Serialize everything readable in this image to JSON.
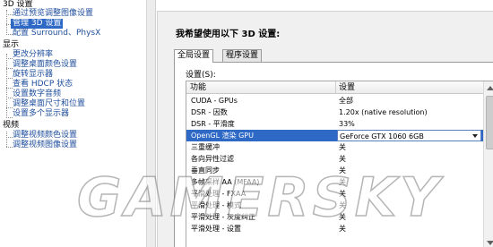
{
  "tree": {
    "categories": [
      {
        "label": "3D 设置",
        "items": [
          "通过预览调整图像设置",
          "管理 3D 设置",
          "配置 Surround、PhysX"
        ]
      },
      {
        "label": "显示",
        "items": [
          "更改分辨率",
          "调整桌面颜色设置",
          "旋转显示器",
          "查看 HDCP 状态",
          "设置数字音频",
          "调整桌面尺寸和位置",
          "设置多个显示器"
        ]
      },
      {
        "label": "视频",
        "items": [
          "调整视频颜色设置",
          "调整视频图像设置"
        ]
      }
    ],
    "selected_item": "管理 3D 设置"
  },
  "panel": {
    "prompt": "我希望使用以下 3D 设置:",
    "tabs": [
      {
        "label": "全局设置",
        "active": true
      },
      {
        "label": "程序设置",
        "active": false
      }
    ],
    "settings_label": "设置(S):",
    "columns": {
      "feature": "功能",
      "setting": "设置"
    },
    "rows": [
      {
        "feature": "CUDA - GPUs",
        "value": "全部"
      },
      {
        "feature": "DSR - 因数",
        "value": "1.20x (native resolution)"
      },
      {
        "feature": "DSR - 平滑度",
        "value": "33%"
      },
      {
        "feature": "OpenGL 渲染 GPU",
        "value": "GeForce GTX 1060 6GB",
        "selected": true
      },
      {
        "feature": "三重缓冲",
        "value": "关"
      },
      {
        "feature": "各向异性过滤",
        "value": "关"
      },
      {
        "feature": "垂直同步",
        "value": "关"
      },
      {
        "feature": "多帧采样 AA (MFAA)",
        "value": "关"
      },
      {
        "feature": "平滑处理 - FXAA",
        "value": "关"
      },
      {
        "feature": "平滑处理 - 模式",
        "value": "关"
      },
      {
        "feature": "平滑处理 - 灰度纠正",
        "value": "关"
      },
      {
        "feature": "平滑处理 - 设置",
        "value": "关"
      }
    ]
  },
  "watermark": "GAMERSKY",
  "colors": {
    "selection": "#2f69c6",
    "link": "#1f4e9c",
    "panel_bg": "#f0f0f0"
  },
  "icons": [
    "chevron-down-icon",
    "scroll-up-arrow-icon",
    "scroll-down-arrow-icon"
  ]
}
